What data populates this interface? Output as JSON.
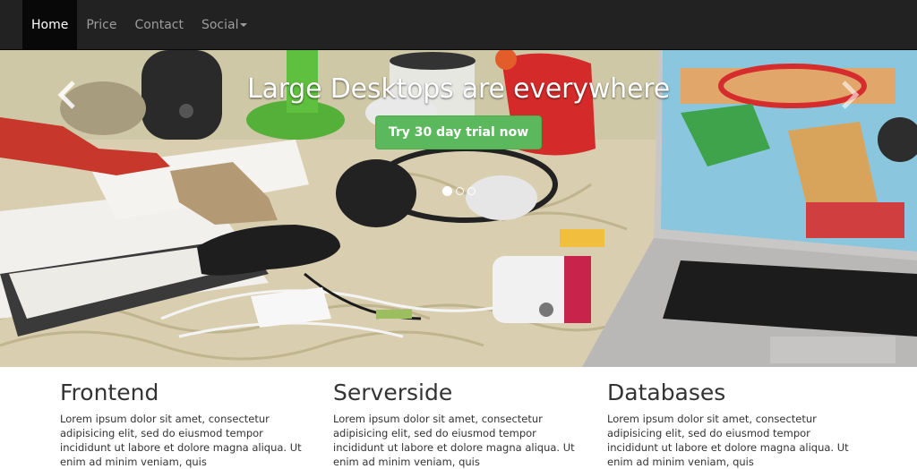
{
  "nav": {
    "items": [
      {
        "label": "Home",
        "active": true
      },
      {
        "label": "Price",
        "active": false
      },
      {
        "label": "Contact",
        "active": false
      },
      {
        "label": "Social",
        "active": false,
        "dropdown": true
      }
    ]
  },
  "carousel": {
    "title": "Large Desktops are everywhere",
    "button": "Try 30 day trial now",
    "slide_count": 3,
    "active_slide": 1,
    "prev_icon": "chevron-left-icon",
    "next_icon": "chevron-right-icon"
  },
  "features": [
    {
      "title": "Frontend",
      "text": "Lorem ipsum dolor sit amet, consectetur adipisicing elit, sed do eiusmod tempor incididunt ut labore et dolore magna aliqua. Ut enim ad minim veniam, quis"
    },
    {
      "title": "Serverside",
      "text": "Lorem ipsum dolor sit amet, consectetur adipisicing elit, sed do eiusmod tempor incididunt ut labore et dolore magna aliqua. Ut enim ad minim veniam, quis"
    },
    {
      "title": "Databases",
      "text": "Lorem ipsum dolor sit amet, consectetur adipisicing elit, sed do eiusmod tempor incididunt ut labore et dolore magna aliqua. Ut enim ad minim veniam, quis"
    }
  ],
  "colors": {
    "navbar": "#222222",
    "cta": "#5cb85c"
  }
}
